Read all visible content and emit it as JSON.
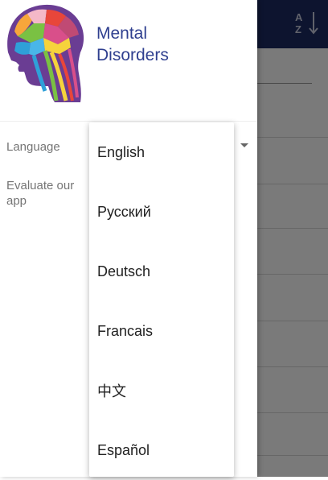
{
  "app": {
    "title": "Mental\nDisorders",
    "sort_icon": "sort-alpha-down-icon",
    "accent_color": "#1d2a63"
  },
  "drawer": {
    "items": [
      {
        "label": "Language"
      },
      {
        "label": "Evaluate our app"
      }
    ]
  },
  "language_dropdown": {
    "options": [
      "English",
      "Русский",
      "Deutsch",
      "Francais",
      "中文",
      "Español"
    ]
  }
}
